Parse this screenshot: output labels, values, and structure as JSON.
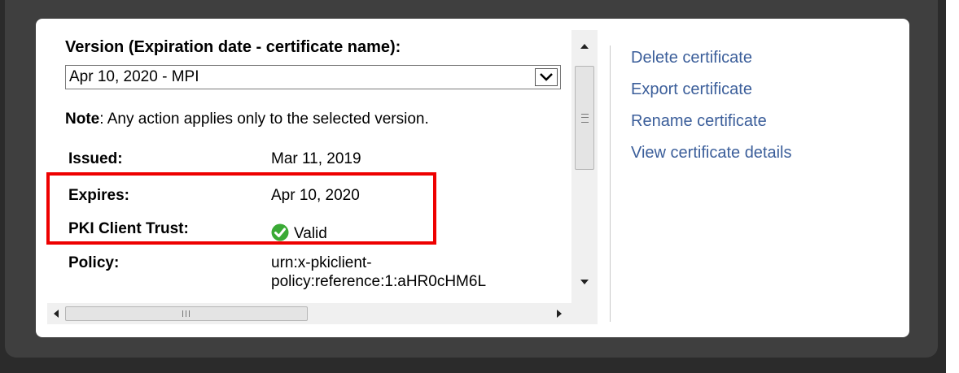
{
  "version": {
    "label": "Version (Expiration date - certificate name):",
    "selected": "Apr 10, 2020 - MPI",
    "note_bold": "Note",
    "note_text": ": Any action applies only to the selected version."
  },
  "properties": [
    {
      "label": "Issued:",
      "value": "Mar 11, 2019"
    },
    {
      "label": "Expires:",
      "value": "Apr 10, 2020"
    },
    {
      "label": "PKI Client Trust:",
      "value": "Valid",
      "icon": "check-circle-icon",
      "icon_color": "#3aaa35"
    },
    {
      "label": "Policy:",
      "value_line1": "urn:x-pkiclient-",
      "value_line2": "policy:reference:1:aHR0cHM6L"
    }
  ],
  "actions": [
    "Delete certificate",
    "Export certificate",
    "Rename certificate",
    "View certificate details"
  ],
  "colors": {
    "link": "#3b5e9a",
    "highlight": "#ee0000",
    "background_dark": "#2b2b2b"
  }
}
